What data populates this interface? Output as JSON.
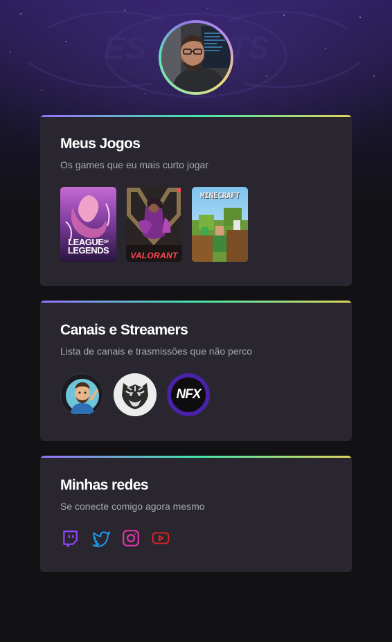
{
  "profile": {
    "avatar_alt": "avatar"
  },
  "games_section": {
    "title": "Meus Jogos",
    "subtitle": "Os games que eu mais curto jogar",
    "games": [
      {
        "line1": "LEAGUE",
        "of": "OF",
        "line2": "LEGENDS"
      },
      {
        "label": "VALORANT"
      },
      {
        "label": "MINECRAFT"
      }
    ]
  },
  "streamers_section": {
    "title": "Canais e Streamers",
    "subtitle": "Lista de canais e trasmissões que não perco",
    "streamers": [
      {
        "name": "cartoon-avatar"
      },
      {
        "name": "tiger-avatar"
      },
      {
        "logo_text": "NFX"
      }
    ]
  },
  "social_section": {
    "title": "Minhas redes",
    "subtitle": "Se conecte comigo agora mesmo",
    "icons": [
      "twitch-icon",
      "twitter-icon",
      "instagram-icon",
      "youtube-icon"
    ]
  },
  "colors": {
    "background": "#121214",
    "card": "#29262f",
    "accent_purple": "#9572fc",
    "accent_green": "#43e7ad",
    "accent_yellow": "#e2d45c",
    "twitch": "#9146ff",
    "twitter": "#1d9bf0",
    "instagram": "#e535ab",
    "youtube": "#e02424"
  }
}
